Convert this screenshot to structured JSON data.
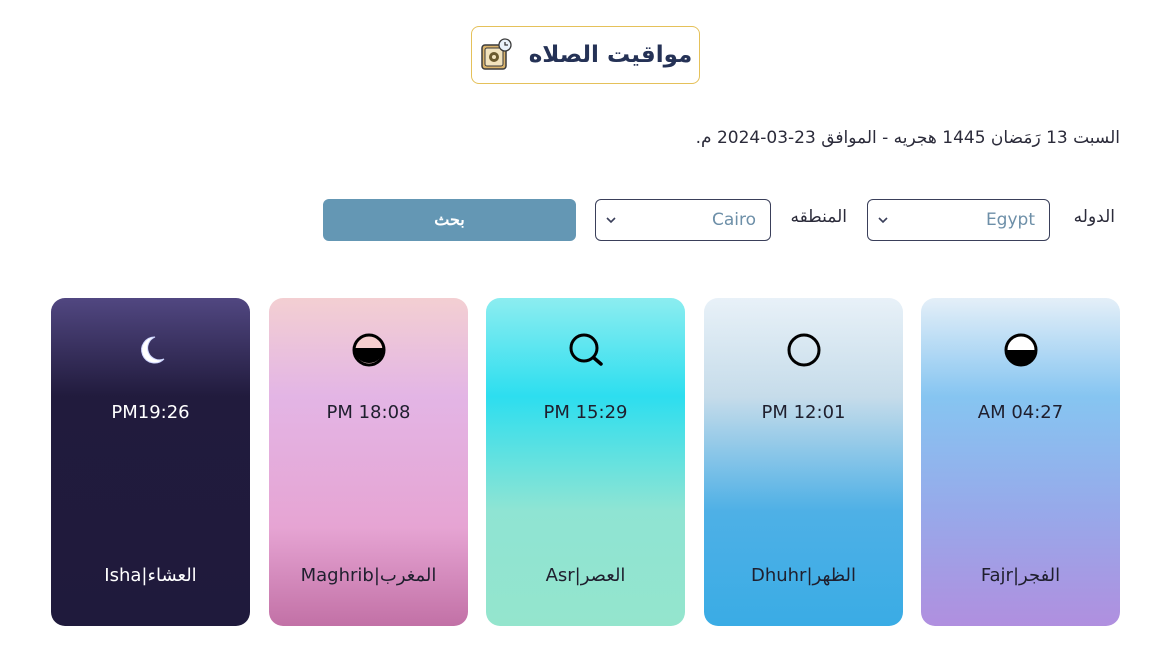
{
  "header": {
    "title": "مواقيت الصلاه",
    "icon": "prayer-clock-icon"
  },
  "date_line": "السبت 13 رَمَضان 1445 هجريه - الموافق 23-03-2024 م.",
  "form": {
    "country_label": "الدوله",
    "country_value": "Egypt",
    "region_label": "المنطقه",
    "region_value": "Cairo",
    "search_label": "بحث"
  },
  "cards": [
    {
      "key": "fajr",
      "time": "AM 04:27",
      "name": "Fajr|الفجر",
      "icon": "half-filled-circle-icon"
    },
    {
      "key": "dhuhr",
      "time": "PM 12:01",
      "name": "Dhuhr|الظهر",
      "icon": "circle-icon"
    },
    {
      "key": "asr",
      "time": "PM 15:29",
      "name": "Asr|العصر",
      "icon": "circle-tail-icon"
    },
    {
      "key": "maghrib",
      "time": "PM 18:08",
      "name": "Maghrib|المغرب",
      "icon": "sunset-circle-icon"
    },
    {
      "key": "isha",
      "time": "PM19:26",
      "name": "Isha|العشاء",
      "icon": "crescent-moon-icon"
    }
  ],
  "colors": {
    "title_border": "#e5c15a",
    "button": "#6497b4",
    "select_text": "#6d8fa8"
  }
}
